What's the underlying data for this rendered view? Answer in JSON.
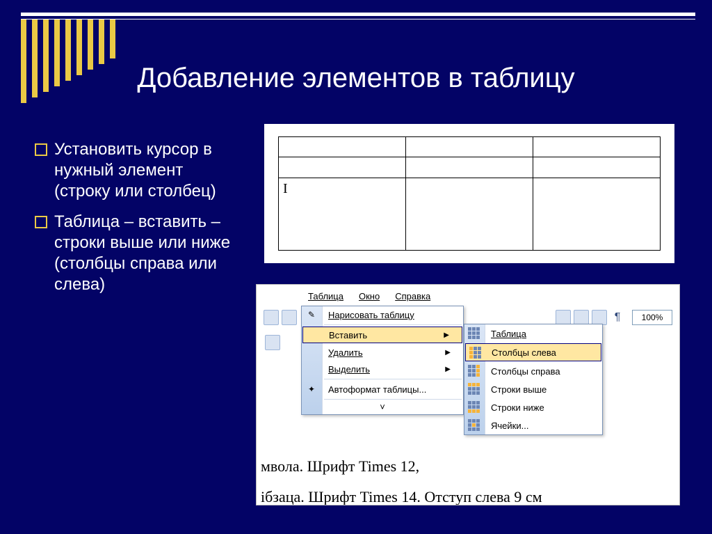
{
  "title": "Добавление элементов в таблицу",
  "bullets": [
    "Установить курсор в нужный элемент (строку или столбец)",
    "Таблица – вставить – строки выше или ниже (столбцы справа или слева)"
  ],
  "sample_table": {
    "cursor_cell": "I"
  },
  "menubar": {
    "table": "Таблица",
    "window": "Окно",
    "help": "Справка"
  },
  "menu": {
    "draw": "Нарисовать таблицу",
    "insert": "Вставить",
    "delete": "Удалить",
    "select": "Выделить",
    "autoformat": "Автоформат таблицы..."
  },
  "submenu": {
    "table": "Таблица",
    "cols_left": "Столбцы слева",
    "cols_right": "Столбцы справа",
    "rows_above": "Строки выше",
    "rows_below": "Строки ниже",
    "cells": "Ячейки..."
  },
  "toolbar": {
    "zoom": "100%"
  },
  "doc": {
    "line1_fragment": "мвола. Шрифт Times 12,",
    "line2_fragment": "ібзаца. Шрифт Times 14. Отступ слева 9 см"
  },
  "glyphs": {
    "arrow_right": "▶",
    "pilcrow": "¶",
    "chevrons": "˅",
    "pencil": "✎",
    "sparkle": "✦"
  }
}
